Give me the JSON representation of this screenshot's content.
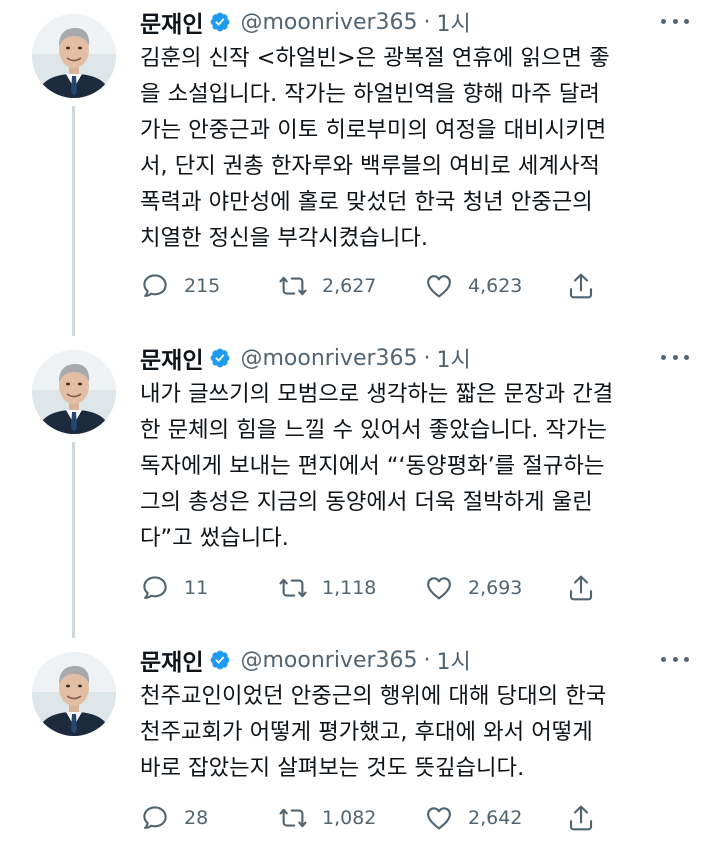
{
  "author": {
    "name": "문재인",
    "handle": "@moonriver365",
    "separator": "·"
  },
  "colors": {
    "verified": "#1d9bf0",
    "secondary_text": "#536471",
    "thread_line": "#cfd9de"
  },
  "icons": {
    "reply": "speech-bubble-icon",
    "retweet": "retweet-arrows-icon",
    "like": "heart-icon",
    "share": "share-upload-icon",
    "verified": "verified-badge-icon",
    "more": "more-dots-icon"
  },
  "tweets": [
    {
      "time": "1시",
      "lines": [
        "김훈의 신작 <하얼빈>은 광복절 연휴에 읽으면 좋",
        "을 소설입니다. 작가는 하얼빈역을 향해 마주 달려",
        "가는 안중근과 이토 히로부미의 여정을 대비시키면",
        "서, 단지 권총 한자루와 백루블의 여비로 세계사적",
        "폭력과 야만성에 홀로 맞섰던 한국 청년 안중근의",
        "치열한 정신을 부각시켰습니다."
      ],
      "replies": "215",
      "retweets": "2,627",
      "likes": "4,623"
    },
    {
      "time": "1시",
      "lines": [
        "내가 글쓰기의 모범으로 생각하는 짧은 문장과 간결",
        "한 문체의 힘을 느낄 수 있어서 좋았습니다. 작가는",
        "독자에게 보내는 편지에서 “‘동양평화’를 절규하는",
        "그의 총성은 지금의 동양에서 더욱 절박하게 울린",
        "다”고 썼습니다."
      ],
      "replies": "11",
      "retweets": "1,118",
      "likes": "2,693"
    },
    {
      "time": "1시",
      "lines": [
        "천주교인이었던 안중근의 행위에 대해 당대의 한국",
        "천주교회가 어떻게 평가했고, 후대에 와서 어떻게",
        "바로 잡았는지 살펴보는 것도 뜻깊습니다."
      ],
      "replies": "28",
      "retweets": "1,082",
      "likes": "2,642"
    }
  ]
}
